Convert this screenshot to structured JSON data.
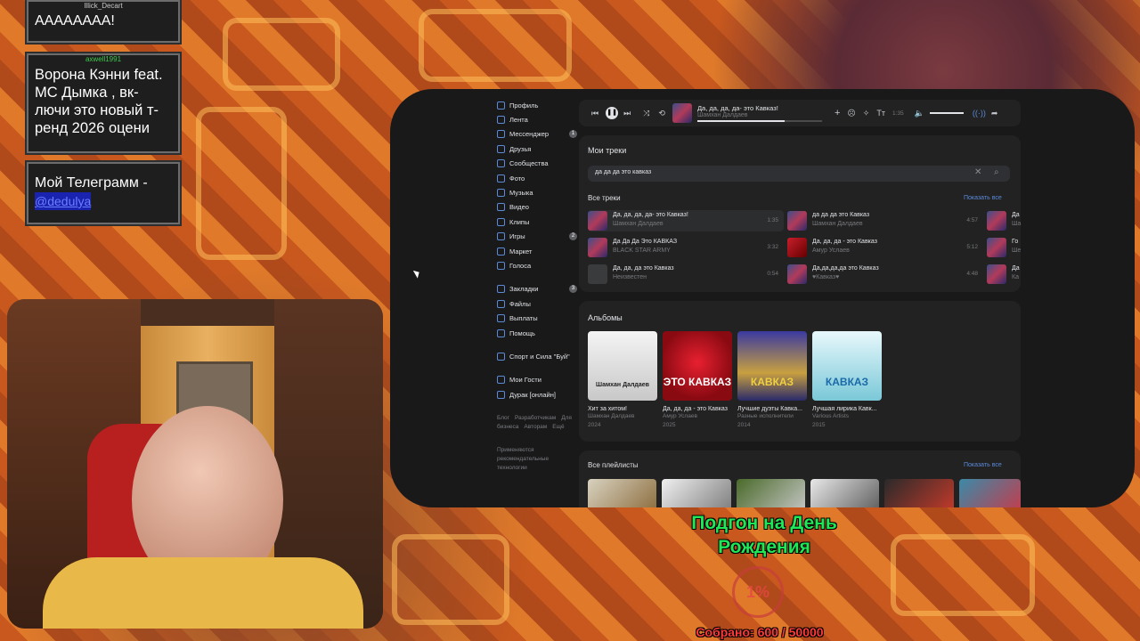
{
  "chat": [
    {
      "user": "Illick_Decart",
      "text": "АААААААА!"
    },
    {
      "user": "axwell1991",
      "text": "Ворона Кэнни feat. МС Дымка , вк-лючи это новый т-ренд 2026 оцени"
    },
    {
      "user": "",
      "text": "Мой Телеграмм -",
      "link": "@dedulya"
    }
  ],
  "sidebar": {
    "items": [
      {
        "label": "Профиль",
        "badge": ""
      },
      {
        "label": "Лента",
        "badge": ""
      },
      {
        "label": "Мессенджер",
        "badge": "1"
      },
      {
        "label": "Друзья",
        "badge": ""
      },
      {
        "label": "Сообщества",
        "badge": ""
      },
      {
        "label": "Фото",
        "badge": ""
      },
      {
        "label": "Музыка",
        "badge": ""
      },
      {
        "label": "Видео",
        "badge": ""
      },
      {
        "label": "Клипы",
        "badge": ""
      },
      {
        "label": "Игры",
        "badge": "2"
      },
      {
        "label": "Маркет",
        "badge": ""
      },
      {
        "label": "Голоса",
        "badge": ""
      }
    ],
    "items2": [
      {
        "label": "Закладки",
        "badge": "3"
      },
      {
        "label": "Файлы",
        "badge": ""
      },
      {
        "label": "Выплаты",
        "badge": ""
      },
      {
        "label": "Помощь",
        "badge": ""
      }
    ],
    "group": "Спорт и Сила \"Буй\"",
    "apps": [
      "Мои Гости",
      "Дурак [онлайн]"
    ],
    "footer": [
      "Блог",
      "Разработчикам",
      "Для бизнеса",
      "Авторам",
      "Ещё"
    ],
    "recommend": "Применяются рекомендательные технологии"
  },
  "player": {
    "title": "Да, да, да, да- это Кавказ!",
    "artist": "Шамхан Далдаев",
    "time": "1:35"
  },
  "my_tracks": {
    "heading": "Мои треки",
    "search_value": "да да да это кавказ",
    "all_tracks": "Все треки",
    "show_all": "Показать все",
    "tracks": [
      {
        "title": "Да, да, да, да- это Кавказ!",
        "artist": "Шамхан Далдаев",
        "dur": "1:35"
      },
      {
        "title": "Да Да Да Это КАВКАЗ",
        "artist": "BLACK STAR ARMY",
        "dur": "3:32"
      },
      {
        "title": "Да, да, да это Кавказ",
        "artist": "Неизвестен",
        "dur": "0:54"
      },
      {
        "title": "да да да это Кавказ",
        "artist": "Шамхан Далдаев",
        "dur": "4:57"
      },
      {
        "title": "Да, да, да - это Кавказ",
        "artist": "Амур Услаев",
        "dur": "5:12"
      },
      {
        "title": "Да,да,да,да это Кавказ",
        "artist": "♥Кавказ♥",
        "dur": "4:48"
      },
      {
        "title": "Да",
        "artist": "Ша"
      },
      {
        "title": "Го",
        "artist": "Ше"
      },
      {
        "title": "Да",
        "artist": "Ка"
      }
    ]
  },
  "albums": {
    "heading": "Альбомы",
    "items": [
      {
        "name": "Хит за хитом!",
        "artist": "Шамхан Далдаев",
        "year": "2024",
        "cover_text": "Шамхан Далдаев"
      },
      {
        "name": "Да, да, да - это Кавказ",
        "artist": "Амур Услаев",
        "year": "2025",
        "cover_text": "ЭТО КАВКАЗ"
      },
      {
        "name": "Лучшие дуэты Кавка...",
        "artist": "Разные исполнители",
        "year": "2014",
        "cover_text": "КАВКАЗ"
      },
      {
        "name": "Лучшая лирика Кавк...",
        "artist": "Various Artists",
        "year": "2015",
        "cover_text": "КАВКАЗ"
      }
    ]
  },
  "playlists": {
    "heading": "Все плейлисты",
    "show_all": "Показать все"
  },
  "overlay": {
    "goal_title": "Подгон на День Рождения",
    "percent": "1%",
    "collected": "Собрано: 600 / 50000"
  }
}
